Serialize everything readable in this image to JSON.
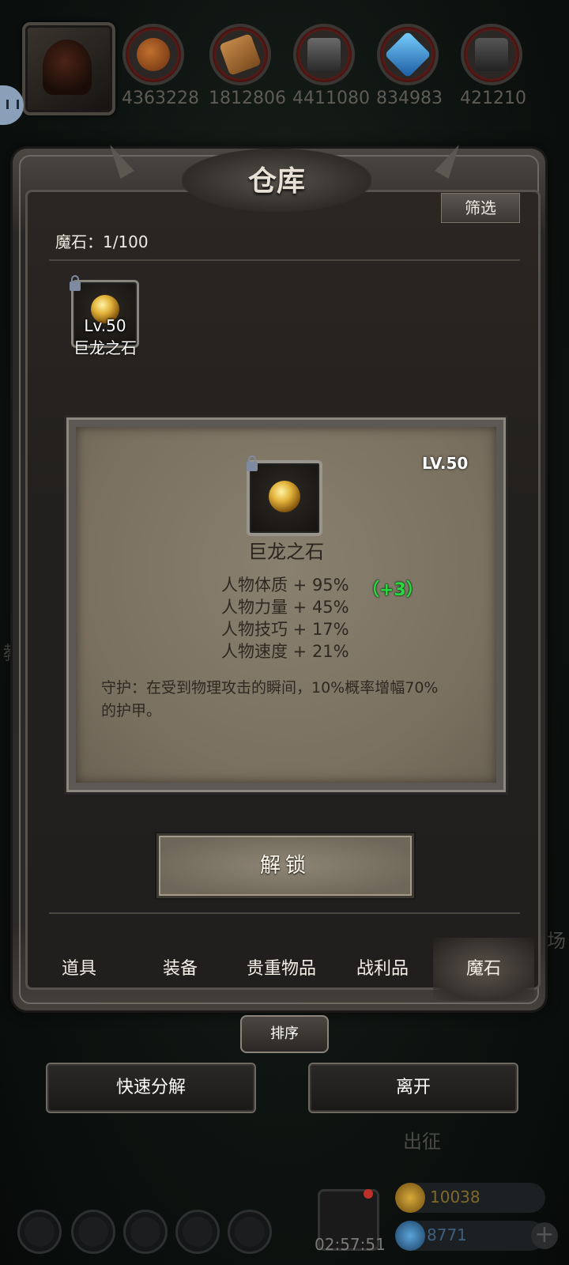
{
  "resources": [
    {
      "icon": "meat-icon",
      "value": "4363228"
    },
    {
      "icon": "wood-icon",
      "value": "1812806"
    },
    {
      "icon": "iron-icon",
      "value": "4411080"
    },
    {
      "icon": "crystal-icon",
      "value": "834983"
    },
    {
      "icon": "stone-icon",
      "value": "421210"
    }
  ],
  "panel": {
    "title": "仓库",
    "filter_label": "筛选",
    "count_label": "魔石：1/100",
    "items": [
      {
        "level": "Lv.50",
        "name": "巨龙之石"
      }
    ]
  },
  "detail": {
    "level": "LV.50",
    "name": "巨龙之石",
    "stats": [
      {
        "text": "人物体质 + 95%",
        "bonus": "（+3）"
      },
      {
        "text": "人物力量 + 45%"
      },
      {
        "text": "人物技巧 + 17%"
      },
      {
        "text": "人物速度 + 21%"
      }
    ],
    "description": "守护：在受到物理攻击的瞬间，10%概率增幅70%的护甲。",
    "unlock_label": "解锁"
  },
  "tabs": [
    {
      "label": "道具",
      "active": false
    },
    {
      "label": "装备",
      "active": false
    },
    {
      "label": "贵重物品",
      "active": false
    },
    {
      "label": "战利品",
      "active": false
    },
    {
      "label": "魔石",
      "active": true
    }
  ],
  "sort_label": "排序",
  "quick_disassemble_label": "快速分解",
  "leave_label": "离开",
  "background": {
    "side_label_left": "教",
    "side_label_right": "场",
    "expedition_label": "出征",
    "gold": "10038",
    "gems": "8771",
    "timer": "02:57:51"
  },
  "colors": {
    "accent_green": "#28d840",
    "text_light": "#f0ebe2",
    "card_bg": "#7a7060"
  }
}
